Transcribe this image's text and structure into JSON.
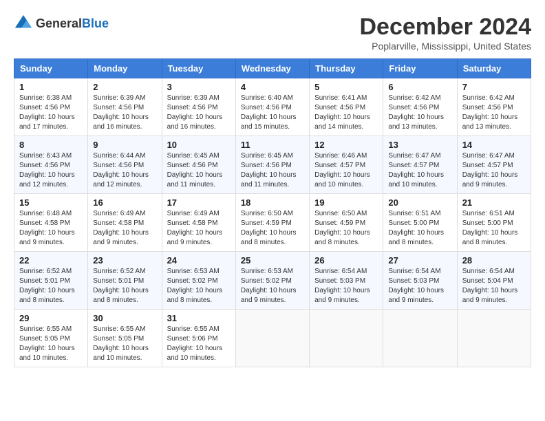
{
  "logo": {
    "general": "General",
    "blue": "Blue"
  },
  "title": {
    "month_year": "December 2024",
    "location": "Poplarville, Mississippi, United States"
  },
  "headers": [
    "Sunday",
    "Monday",
    "Tuesday",
    "Wednesday",
    "Thursday",
    "Friday",
    "Saturday"
  ],
  "weeks": [
    [
      {
        "day": "1",
        "info": "Sunrise: 6:38 AM\nSunset: 4:56 PM\nDaylight: 10 hours\nand 17 minutes."
      },
      {
        "day": "2",
        "info": "Sunrise: 6:39 AM\nSunset: 4:56 PM\nDaylight: 10 hours\nand 16 minutes."
      },
      {
        "day": "3",
        "info": "Sunrise: 6:39 AM\nSunset: 4:56 PM\nDaylight: 10 hours\nand 16 minutes."
      },
      {
        "day": "4",
        "info": "Sunrise: 6:40 AM\nSunset: 4:56 PM\nDaylight: 10 hours\nand 15 minutes."
      },
      {
        "day": "5",
        "info": "Sunrise: 6:41 AM\nSunset: 4:56 PM\nDaylight: 10 hours\nand 14 minutes."
      },
      {
        "day": "6",
        "info": "Sunrise: 6:42 AM\nSunset: 4:56 PM\nDaylight: 10 hours\nand 13 minutes."
      },
      {
        "day": "7",
        "info": "Sunrise: 6:42 AM\nSunset: 4:56 PM\nDaylight: 10 hours\nand 13 minutes."
      }
    ],
    [
      {
        "day": "8",
        "info": "Sunrise: 6:43 AM\nSunset: 4:56 PM\nDaylight: 10 hours\nand 12 minutes."
      },
      {
        "day": "9",
        "info": "Sunrise: 6:44 AM\nSunset: 4:56 PM\nDaylight: 10 hours\nand 12 minutes."
      },
      {
        "day": "10",
        "info": "Sunrise: 6:45 AM\nSunset: 4:56 PM\nDaylight: 10 hours\nand 11 minutes."
      },
      {
        "day": "11",
        "info": "Sunrise: 6:45 AM\nSunset: 4:56 PM\nDaylight: 10 hours\nand 11 minutes."
      },
      {
        "day": "12",
        "info": "Sunrise: 6:46 AM\nSunset: 4:57 PM\nDaylight: 10 hours\nand 10 minutes."
      },
      {
        "day": "13",
        "info": "Sunrise: 6:47 AM\nSunset: 4:57 PM\nDaylight: 10 hours\nand 10 minutes."
      },
      {
        "day": "14",
        "info": "Sunrise: 6:47 AM\nSunset: 4:57 PM\nDaylight: 10 hours\nand 9 minutes."
      }
    ],
    [
      {
        "day": "15",
        "info": "Sunrise: 6:48 AM\nSunset: 4:58 PM\nDaylight: 10 hours\nand 9 minutes."
      },
      {
        "day": "16",
        "info": "Sunrise: 6:49 AM\nSunset: 4:58 PM\nDaylight: 10 hours\nand 9 minutes."
      },
      {
        "day": "17",
        "info": "Sunrise: 6:49 AM\nSunset: 4:58 PM\nDaylight: 10 hours\nand 9 minutes."
      },
      {
        "day": "18",
        "info": "Sunrise: 6:50 AM\nSunset: 4:59 PM\nDaylight: 10 hours\nand 8 minutes."
      },
      {
        "day": "19",
        "info": "Sunrise: 6:50 AM\nSunset: 4:59 PM\nDaylight: 10 hours\nand 8 minutes."
      },
      {
        "day": "20",
        "info": "Sunrise: 6:51 AM\nSunset: 5:00 PM\nDaylight: 10 hours\nand 8 minutes."
      },
      {
        "day": "21",
        "info": "Sunrise: 6:51 AM\nSunset: 5:00 PM\nDaylight: 10 hours\nand 8 minutes."
      }
    ],
    [
      {
        "day": "22",
        "info": "Sunrise: 6:52 AM\nSunset: 5:01 PM\nDaylight: 10 hours\nand 8 minutes."
      },
      {
        "day": "23",
        "info": "Sunrise: 6:52 AM\nSunset: 5:01 PM\nDaylight: 10 hours\nand 8 minutes."
      },
      {
        "day": "24",
        "info": "Sunrise: 6:53 AM\nSunset: 5:02 PM\nDaylight: 10 hours\nand 8 minutes."
      },
      {
        "day": "25",
        "info": "Sunrise: 6:53 AM\nSunset: 5:02 PM\nDaylight: 10 hours\nand 9 minutes."
      },
      {
        "day": "26",
        "info": "Sunrise: 6:54 AM\nSunset: 5:03 PM\nDaylight: 10 hours\nand 9 minutes."
      },
      {
        "day": "27",
        "info": "Sunrise: 6:54 AM\nSunset: 5:03 PM\nDaylight: 10 hours\nand 9 minutes."
      },
      {
        "day": "28",
        "info": "Sunrise: 6:54 AM\nSunset: 5:04 PM\nDaylight: 10 hours\nand 9 minutes."
      }
    ],
    [
      {
        "day": "29",
        "info": "Sunrise: 6:55 AM\nSunset: 5:05 PM\nDaylight: 10 hours\nand 10 minutes."
      },
      {
        "day": "30",
        "info": "Sunrise: 6:55 AM\nSunset: 5:05 PM\nDaylight: 10 hours\nand 10 minutes."
      },
      {
        "day": "31",
        "info": "Sunrise: 6:55 AM\nSunset: 5:06 PM\nDaylight: 10 hours\nand 10 minutes."
      },
      {
        "day": "",
        "info": ""
      },
      {
        "day": "",
        "info": ""
      },
      {
        "day": "",
        "info": ""
      },
      {
        "day": "",
        "info": ""
      }
    ]
  ]
}
